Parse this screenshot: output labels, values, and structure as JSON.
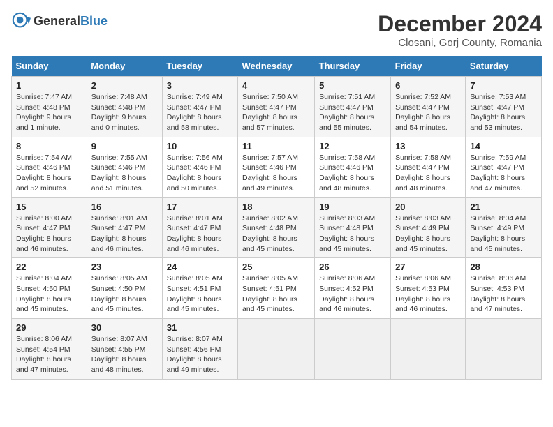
{
  "header": {
    "logo_general": "General",
    "logo_blue": "Blue",
    "main_title": "December 2024",
    "sub_title": "Closani, Gorj County, Romania"
  },
  "weekdays": [
    "Sunday",
    "Monday",
    "Tuesday",
    "Wednesday",
    "Thursday",
    "Friday",
    "Saturday"
  ],
  "weeks": [
    [
      {
        "day": "1",
        "sunrise": "7:47 AM",
        "sunset": "4:48 PM",
        "daylight": "9 hours and 1 minute."
      },
      {
        "day": "2",
        "sunrise": "7:48 AM",
        "sunset": "4:48 PM",
        "daylight": "9 hours and 0 minutes."
      },
      {
        "day": "3",
        "sunrise": "7:49 AM",
        "sunset": "4:47 PM",
        "daylight": "8 hours and 58 minutes."
      },
      {
        "day": "4",
        "sunrise": "7:50 AM",
        "sunset": "4:47 PM",
        "daylight": "8 hours and 57 minutes."
      },
      {
        "day": "5",
        "sunrise": "7:51 AM",
        "sunset": "4:47 PM",
        "daylight": "8 hours and 55 minutes."
      },
      {
        "day": "6",
        "sunrise": "7:52 AM",
        "sunset": "4:47 PM",
        "daylight": "8 hours and 54 minutes."
      },
      {
        "day": "7",
        "sunrise": "7:53 AM",
        "sunset": "4:47 PM",
        "daylight": "8 hours and 53 minutes."
      }
    ],
    [
      {
        "day": "8",
        "sunrise": "7:54 AM",
        "sunset": "4:46 PM",
        "daylight": "8 hours and 52 minutes."
      },
      {
        "day": "9",
        "sunrise": "7:55 AM",
        "sunset": "4:46 PM",
        "daylight": "8 hours and 51 minutes."
      },
      {
        "day": "10",
        "sunrise": "7:56 AM",
        "sunset": "4:46 PM",
        "daylight": "8 hours and 50 minutes."
      },
      {
        "day": "11",
        "sunrise": "7:57 AM",
        "sunset": "4:46 PM",
        "daylight": "8 hours and 49 minutes."
      },
      {
        "day": "12",
        "sunrise": "7:58 AM",
        "sunset": "4:46 PM",
        "daylight": "8 hours and 48 minutes."
      },
      {
        "day": "13",
        "sunrise": "7:58 AM",
        "sunset": "4:47 PM",
        "daylight": "8 hours and 48 minutes."
      },
      {
        "day": "14",
        "sunrise": "7:59 AM",
        "sunset": "4:47 PM",
        "daylight": "8 hours and 47 minutes."
      }
    ],
    [
      {
        "day": "15",
        "sunrise": "8:00 AM",
        "sunset": "4:47 PM",
        "daylight": "8 hours and 46 minutes."
      },
      {
        "day": "16",
        "sunrise": "8:01 AM",
        "sunset": "4:47 PM",
        "daylight": "8 hours and 46 minutes."
      },
      {
        "day": "17",
        "sunrise": "8:01 AM",
        "sunset": "4:47 PM",
        "daylight": "8 hours and 46 minutes."
      },
      {
        "day": "18",
        "sunrise": "8:02 AM",
        "sunset": "4:48 PM",
        "daylight": "8 hours and 45 minutes."
      },
      {
        "day": "19",
        "sunrise": "8:03 AM",
        "sunset": "4:48 PM",
        "daylight": "8 hours and 45 minutes."
      },
      {
        "day": "20",
        "sunrise": "8:03 AM",
        "sunset": "4:49 PM",
        "daylight": "8 hours and 45 minutes."
      },
      {
        "day": "21",
        "sunrise": "8:04 AM",
        "sunset": "4:49 PM",
        "daylight": "8 hours and 45 minutes."
      }
    ],
    [
      {
        "day": "22",
        "sunrise": "8:04 AM",
        "sunset": "4:50 PM",
        "daylight": "8 hours and 45 minutes."
      },
      {
        "day": "23",
        "sunrise": "8:05 AM",
        "sunset": "4:50 PM",
        "daylight": "8 hours and 45 minutes."
      },
      {
        "day": "24",
        "sunrise": "8:05 AM",
        "sunset": "4:51 PM",
        "daylight": "8 hours and 45 minutes."
      },
      {
        "day": "25",
        "sunrise": "8:05 AM",
        "sunset": "4:51 PM",
        "daylight": "8 hours and 45 minutes."
      },
      {
        "day": "26",
        "sunrise": "8:06 AM",
        "sunset": "4:52 PM",
        "daylight": "8 hours and 46 minutes."
      },
      {
        "day": "27",
        "sunrise": "8:06 AM",
        "sunset": "4:53 PM",
        "daylight": "8 hours and 46 minutes."
      },
      {
        "day": "28",
        "sunrise": "8:06 AM",
        "sunset": "4:53 PM",
        "daylight": "8 hours and 47 minutes."
      }
    ],
    [
      {
        "day": "29",
        "sunrise": "8:06 AM",
        "sunset": "4:54 PM",
        "daylight": "8 hours and 47 minutes."
      },
      {
        "day": "30",
        "sunrise": "8:07 AM",
        "sunset": "4:55 PM",
        "daylight": "8 hours and 48 minutes."
      },
      {
        "day": "31",
        "sunrise": "8:07 AM",
        "sunset": "4:56 PM",
        "daylight": "8 hours and 49 minutes."
      },
      null,
      null,
      null,
      null
    ]
  ]
}
